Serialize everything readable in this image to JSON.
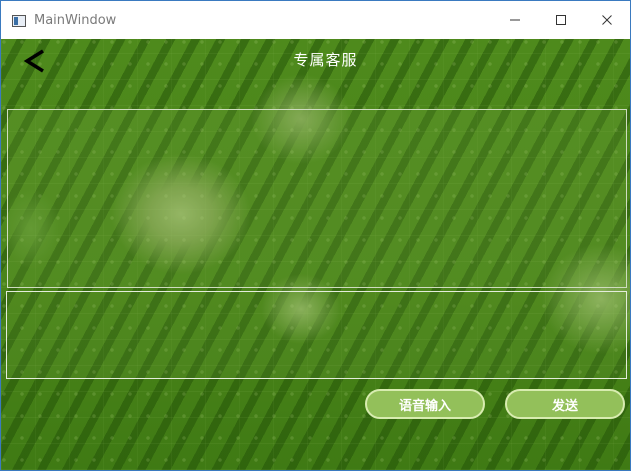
{
  "window": {
    "title": "MainWindow",
    "minimize_icon": "minimize-icon",
    "maximize_icon": "maximize-icon",
    "close_icon": "close-icon"
  },
  "header": {
    "back_icon": "chevron-left-icon",
    "title": "专属客服"
  },
  "chat": {
    "messages": [],
    "input_value": "",
    "input_placeholder": ""
  },
  "actions": {
    "voice_input_label": "语音输入",
    "send_label": "发送"
  },
  "colors": {
    "accent_button": "#93c05a",
    "button_border": "#d8ecb0",
    "background_green": "#4a8a1a",
    "title_text": "#ffffff"
  }
}
